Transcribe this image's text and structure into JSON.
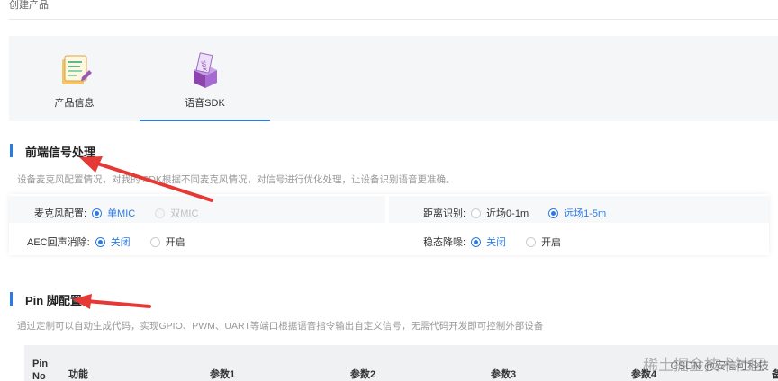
{
  "page": {
    "title": "创建产品"
  },
  "tabs": [
    {
      "label": "产品信息",
      "icon": "document-pencil-icon",
      "active": false
    },
    {
      "label": "语音SDK",
      "icon": "sdk-box-icon",
      "active": true
    }
  ],
  "frontend": {
    "title": "前端信号处理",
    "desc": "设备麦克风配置情况，对我的 SDK根据不同麦克风情况，对信号进行优化处理，让设备识别语音更准确。",
    "mic": {
      "label": "麦克风配置:",
      "options": [
        "单MIC",
        "双MIC"
      ],
      "selected": "单MIC"
    },
    "distance": {
      "label": "距离识别:",
      "options": [
        "近场0-1m",
        "远场1-5m"
      ],
      "selected": "远场1-5m"
    },
    "aec": {
      "label": "AEC回声消除:",
      "options": [
        "关闭",
        "开启"
      ],
      "selected": "关闭"
    },
    "denoise": {
      "label": "稳态降噪:",
      "options": [
        "关闭",
        "开启"
      ],
      "selected": "关闭"
    }
  },
  "pin": {
    "title": "Pin 脚配置",
    "desc": "通过定制可以自动生成代码，实现GPIO、PWM、UART等端口根据语音指令输出自定义信号，无需代码开发即可控制外部设备",
    "columns": [
      "Pin No",
      "功能",
      "参数1",
      "参数2",
      "参数3",
      "参数4",
      "备"
    ]
  },
  "watermark": {
    "main": "稀土掘金技术社区",
    "sub": "CSDN @安信可科技"
  },
  "colors": {
    "accent": "#2c7be5",
    "arrow": "#e53935"
  }
}
